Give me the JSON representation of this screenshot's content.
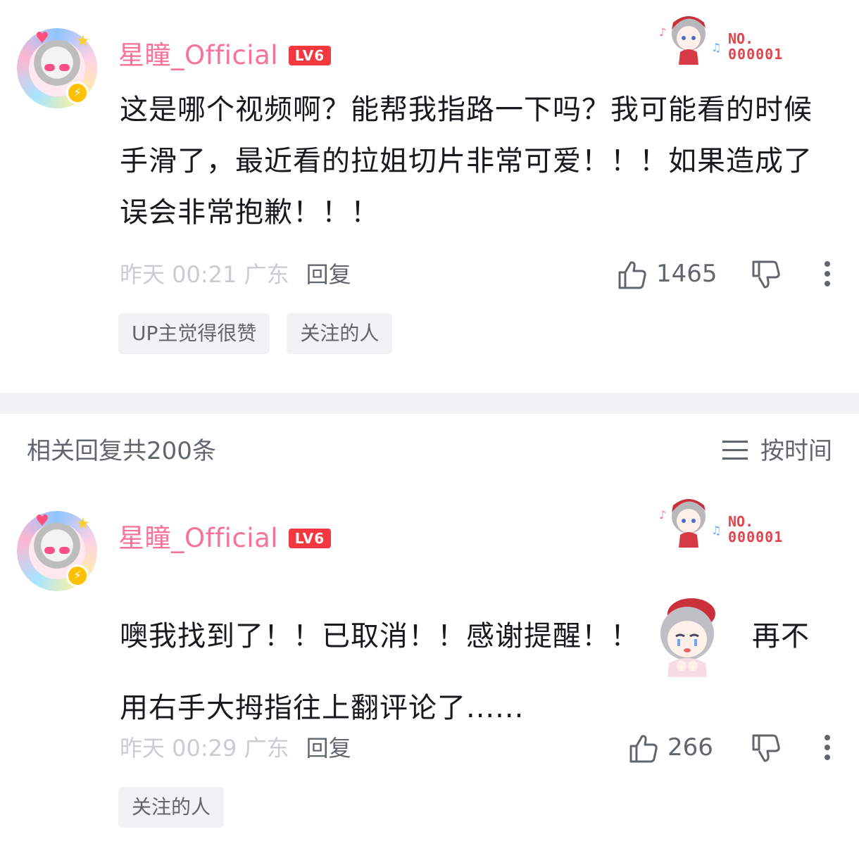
{
  "comments": [
    {
      "username": "星瞳_Official",
      "level": "LV6",
      "fan_badge": {
        "line1": "NO.",
        "line2": "000001"
      },
      "text": "这是哪个视频啊？能帮我指路一下吗？我可能看的时候手滑了，最近看的拉姐切片非常可爱！！！如果造成了误会非常抱歉！！！",
      "meta": "昨天 00:21 广东",
      "reply_label": "回复",
      "likes": "1465",
      "tags": [
        "UP主觉得很赞",
        "关注的人"
      ]
    },
    {
      "username": "星瞳_Official",
      "level": "LV6",
      "fan_badge": {
        "line1": "NO.",
        "line2": "000001"
      },
      "text_before": "噢我找到了！！已取消！！感谢提醒！！",
      "text_after": "再不用右手大拇指往上翻评论了......",
      "meta": "昨天 00:29 广东",
      "reply_label": "回复",
      "likes": "266",
      "tags": [
        "关注的人"
      ]
    }
  ],
  "replies_header": {
    "count_label": "相关回复共200条",
    "sort_label": "按时间"
  },
  "colors": {
    "username": "#fb7299",
    "level_badge": "#f5373f",
    "meta": "#c9ccd0",
    "secondary": "#61666d",
    "tag_bg": "#f1f2f3"
  }
}
